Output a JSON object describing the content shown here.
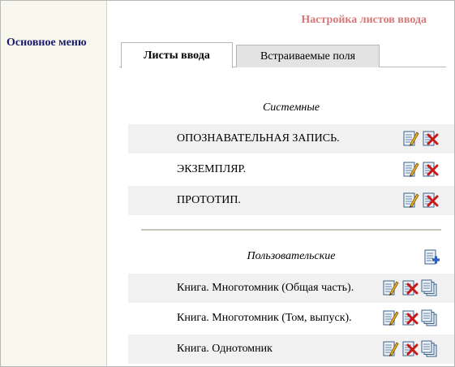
{
  "sidebar": {
    "title": "Основное меню"
  },
  "header": {
    "title": "Настройка листов ввода"
  },
  "tabs": [
    {
      "label": "Листы ввода",
      "active": true
    },
    {
      "label": "Встраиваемые поля",
      "active": false
    }
  ],
  "system_section": {
    "title": "Системные",
    "rows": [
      {
        "label": "ОПОЗНАВАТЕЛЬНАЯ ЗАПИСЬ."
      },
      {
        "label": "ЭКЗЕМПЛЯР."
      },
      {
        "label": "ПРОТОТИП."
      }
    ]
  },
  "user_section": {
    "title": "Пользовательские",
    "rows": [
      {
        "label": "Книга. Многотомник (Общая часть)."
      },
      {
        "label": "Книга. Многотомник (Том, выпуск)."
      },
      {
        "label": "Книга. Однотомник"
      }
    ]
  },
  "icons": {
    "edit": "edit-icon",
    "delete": "delete-icon",
    "copy": "copy-icon",
    "add": "add-icon"
  },
  "colors": {
    "sidebar_bg": "#f7f7ee",
    "title": "#d47878",
    "sidebar_link": "#1a1a6e",
    "row_shade": "#f1f1f1"
  }
}
